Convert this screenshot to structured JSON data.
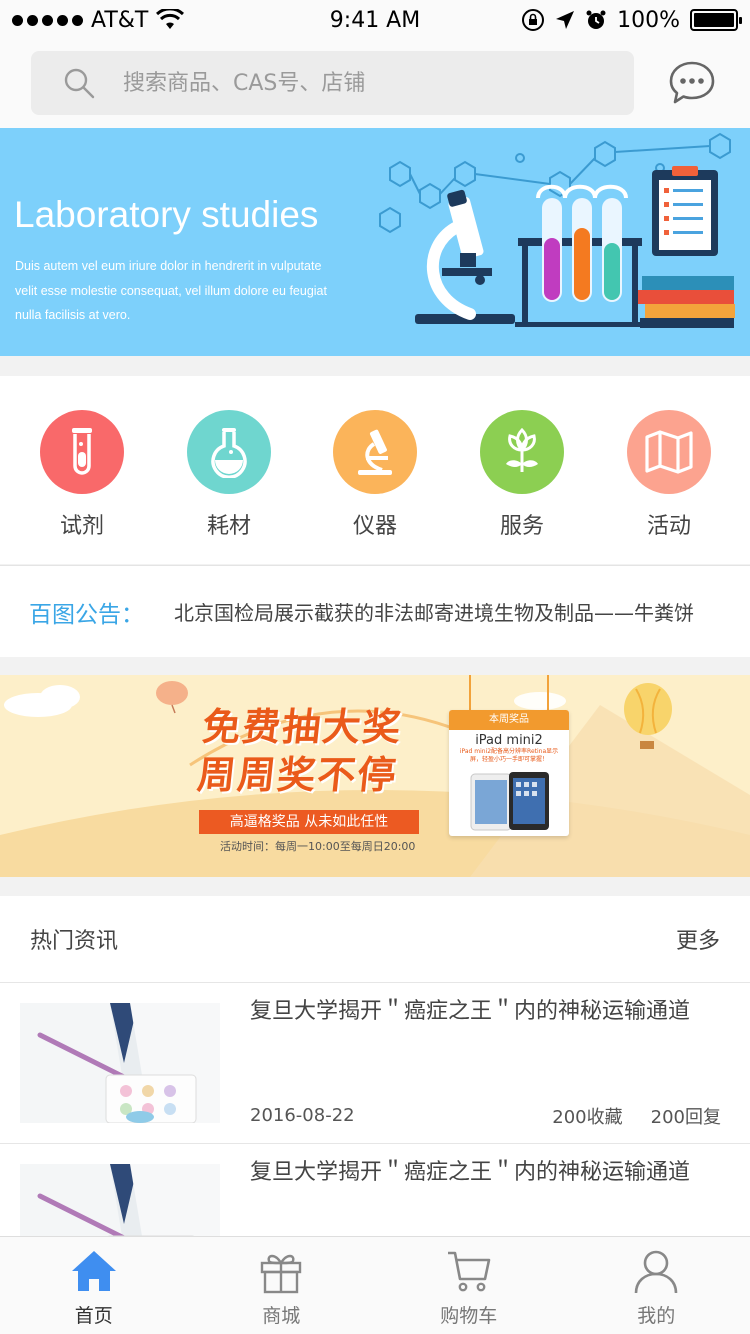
{
  "status_bar": {
    "carrier": "AT&T",
    "time": "9:41 AM",
    "battery": "100%",
    "battery_level": 1.0
  },
  "search": {
    "placeholder": "搜索商品、CAS号、店铺"
  },
  "lab_banner": {
    "title": "Laboratory studies",
    "description": "Duis autem vel eum iriure dolor in hendrerit in vulputate velit esse molestie consequat, vel illum dolore eu feugiat nulla facilisis at vero."
  },
  "categories": [
    {
      "label": "试剂",
      "icon": "test-tube-icon",
      "color": "#f9696a"
    },
    {
      "label": "耗材",
      "icon": "flask-icon",
      "color": "#6fd6cf"
    },
    {
      "label": "仪器",
      "icon": "microscope-icon",
      "color": "#fbb45a"
    },
    {
      "label": "服务",
      "icon": "flower-icon",
      "color": "#8ccf52"
    },
    {
      "label": "活动",
      "icon": "map-icon",
      "color": "#fca38f"
    }
  ],
  "notice": {
    "label": "百图公告：",
    "text": "北京国检局展示截获的非法邮寄进境生物及制品——牛粪饼"
  },
  "promo": {
    "headline_1": "免费抽大奖",
    "headline_2": "周周奖不停",
    "strip": "高逼格奖品 从未如此任性",
    "time": "活动时间：每周一10:00至每周日20:00",
    "prize_header": "本周奖品",
    "prize_name": "iPad mini2",
    "prize_sub": "iPad mini2配备高分辨率Retina显示屏，轻盈小巧一手即可掌握！"
  },
  "hot_news": {
    "title": "热门资讯",
    "more": "更多",
    "items": [
      {
        "headline": "复旦大学揭开＂癌症之王＂内的神秘运输通道",
        "date": "2016-08-22",
        "favorites": "200收藏",
        "replies": "200回复"
      },
      {
        "headline": "复旦大学揭开＂癌症之王＂内的神秘运输通道"
      }
    ]
  },
  "tabbar": [
    {
      "label": "首页",
      "icon": "home-icon",
      "active": true
    },
    {
      "label": "商城",
      "icon": "gift-icon",
      "active": false
    },
    {
      "label": "购物车",
      "icon": "cart-icon",
      "active": false
    },
    {
      "label": "我的",
      "icon": "user-icon",
      "active": false
    }
  ],
  "colors": {
    "accent": "#3aa6e6",
    "tab_active": "#3f8ef0",
    "banner_bg": "#7dd0fb",
    "promo_orange": "#ea5a1a"
  }
}
